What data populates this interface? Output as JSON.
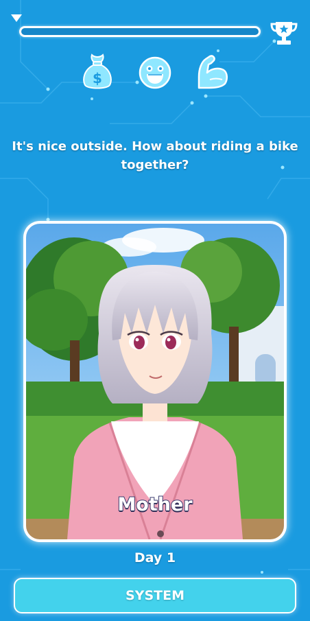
{
  "hud": {
    "menu_icon": "triangle-down-icon",
    "progress_fraction": 0.0,
    "trophy_icon": "trophy-icon",
    "stats": [
      {
        "name": "money",
        "icon": "money-bag-icon"
      },
      {
        "name": "happiness",
        "icon": "smiley-face-icon"
      },
      {
        "name": "strength",
        "icon": "flexed-arm-icon"
      }
    ]
  },
  "dialogue": {
    "question": "It's nice outside. How about riding a bike together?"
  },
  "character": {
    "name": "Mother"
  },
  "footer": {
    "day_label": "Day 1",
    "system_button_label": "SYSTEM"
  },
  "colors": {
    "background": "#1a9be0",
    "icon_fill": "#8fe7ff",
    "button": "#43d2ec"
  }
}
